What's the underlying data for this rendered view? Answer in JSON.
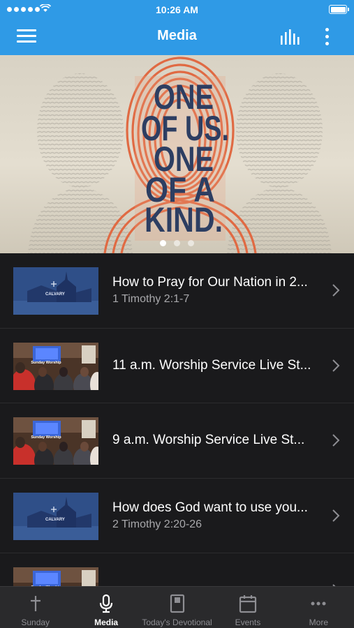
{
  "status_bar": {
    "time": "10:26 AM"
  },
  "header": {
    "title": "Media"
  },
  "hero": {
    "lines": [
      "ONE",
      "OF US.",
      "ONE",
      "OF A",
      "KIND."
    ],
    "pages": 3,
    "active_page": 1
  },
  "media_items": [
    {
      "title": "How to Pray for Our Nation in 2...",
      "subtitle": "1 Timothy 2:1-7",
      "thumb": "church"
    },
    {
      "title": "11 a.m. Worship Service Live St...",
      "subtitle": "",
      "thumb": "worship"
    },
    {
      "title": "9 a.m. Worship Service Live St...",
      "subtitle": "",
      "thumb": "worship"
    },
    {
      "title": "How does God want to use you...",
      "subtitle": "2 Timothy 2:20-26",
      "thumb": "church"
    },
    {
      "title": "",
      "subtitle": "",
      "thumb": "worship"
    }
  ],
  "thumb_text": {
    "church": "CALVARY",
    "worship": "Sunday Worship"
  },
  "tabs": [
    {
      "label": "Sunday",
      "icon": "cross-icon"
    },
    {
      "label": "Media",
      "icon": "microphone-icon"
    },
    {
      "label": "Today's Devotional",
      "icon": "book-icon"
    },
    {
      "label": "Events",
      "icon": "calendar-icon"
    },
    {
      "label": "More",
      "icon": "ellipsis-icon"
    }
  ],
  "active_tab": 1,
  "colors": {
    "accent": "#2f9ae6",
    "list_background": "#1a1a1c",
    "tabbar_background": "#2a2a2c",
    "hero_text": "#2d3e62",
    "hero_fingerprint": "#e06a43"
  }
}
